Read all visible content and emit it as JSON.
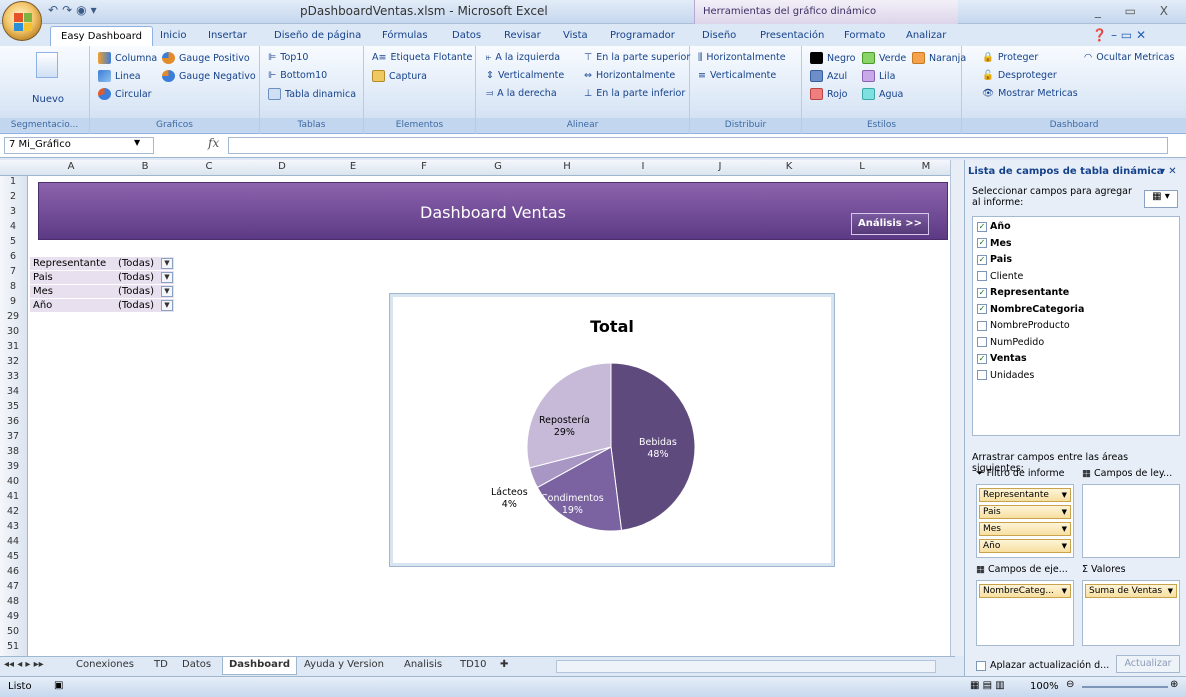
{
  "window": {
    "title": "pDashboardVentas.xlsm - Microsoft Excel",
    "context_title": "Herramientas del gráfico dinámico",
    "controls": "_ ▭ X"
  },
  "tabs": [
    "Easy Dashboard",
    "Inicio",
    "Insertar",
    "Diseño de página",
    "Fórmulas",
    "Datos",
    "Revisar",
    "Vista",
    "Programador",
    "Diseño",
    "Presentación",
    "Formato",
    "Analizar"
  ],
  "active_tab": "Easy Dashboard",
  "ribbon": {
    "segmentacion": {
      "label": "Segmentacio...",
      "nuevo": "Nuevo"
    },
    "graficos": {
      "label": "Graficos",
      "columna": "Columna",
      "linea": "Linea",
      "circular": "Circular",
      "gauge_pos": "Gauge Positivo",
      "gauge_neg": "Gauge Negativo"
    },
    "tablas": {
      "label": "Tablas",
      "top10": "Top10",
      "bottom10": "Bottom10",
      "tabla": "Tabla dinamica"
    },
    "elementos": {
      "label": "Elementos",
      "etiqueta": "Etiqueta Flotante",
      "captura": "Captura"
    },
    "alinear": {
      "label": "Alinear",
      "izq": "A la izquierda",
      "der": "A la derecha",
      "vert": "Verticalmente",
      "sup": "En la parte superior",
      "horiz": "Horizontalmente",
      "inf": "En la parte inferior"
    },
    "distribuir": {
      "label": "Distribuir",
      "horiz": "Horizontalmente",
      "vert": "Verticalmente"
    },
    "estilos": {
      "label": "Estilos",
      "negro": "Negro",
      "verde": "Verde",
      "naranja": "Naranja",
      "azul": "Azul",
      "lila": "Lila",
      "rojo": "Rojo",
      "agua": "Agua"
    },
    "dashboard": {
      "label": "Dashboard",
      "proteger": "Proteger",
      "desproteger": "Desproteger",
      "mostrar": "Mostrar Metricas",
      "ocultar": "Ocultar Metricas"
    }
  },
  "formula_bar": {
    "name_box": "7 Mi_Gráfico",
    "fx": "fx",
    "formula": ""
  },
  "columns": [
    "A",
    "B",
    "C",
    "D",
    "E",
    "F",
    "G",
    "H",
    "I",
    "J",
    "K",
    "L",
    "M"
  ],
  "rows": [
    "1",
    "2",
    "3",
    "4",
    "5",
    "6",
    "7",
    "8",
    "9",
    "29",
    "30",
    "31",
    "32",
    "33",
    "34",
    "35",
    "36",
    "37",
    "38",
    "39",
    "40",
    "41",
    "42",
    "43",
    "44",
    "45",
    "46",
    "47",
    "48",
    "49",
    "50",
    "51"
  ],
  "dashboard": {
    "title": "Dashboard Ventas",
    "analisis_button": "Análisis >>"
  },
  "filters": [
    {
      "label": "Representante",
      "value": "(Todas)"
    },
    {
      "label": "Pais",
      "value": "(Todas)"
    },
    {
      "label": "Mes",
      "value": "(Todas)"
    },
    {
      "label": "Año",
      "value": "(Todas)"
    }
  ],
  "chart_data": {
    "type": "pie",
    "title": "Total",
    "categories": [
      "Bebidas",
      "Condimentos",
      "Lácteos",
      "Repostería"
    ],
    "values": [
      48,
      19,
      4,
      29
    ],
    "labels": [
      "48%",
      "19%",
      "4%",
      "29%"
    ],
    "colors": [
      "#5f4a7e",
      "#7a63a0",
      "#a897c4",
      "#c6bad8"
    ]
  },
  "sheet_tabs": [
    "Conexiones",
    "TD",
    "Datos",
    "Dashboard",
    "Ayuda y Version",
    "Analisis",
    "TD10"
  ],
  "active_sheet": "Dashboard",
  "status": {
    "text": "Listo",
    "zoom": "100%"
  },
  "pivot_panel": {
    "title": "Lista de campos de tabla dinámica",
    "prompt": "Seleccionar campos para agregar al informe:",
    "fields": [
      {
        "name": "Año",
        "checked": true
      },
      {
        "name": "Mes",
        "checked": true
      },
      {
        "name": "Pais",
        "checked": true
      },
      {
        "name": "Cliente",
        "checked": false
      },
      {
        "name": "Representante",
        "checked": true
      },
      {
        "name": "NombreCategoria",
        "checked": true
      },
      {
        "name": "NombreProducto",
        "checked": false
      },
      {
        "name": "NumPedido",
        "checked": false
      },
      {
        "name": "Ventas",
        "checked": true
      },
      {
        "name": "Unidades",
        "checked": false
      }
    ],
    "drag_prompt": "Arrastrar campos entre las áreas siguientes:",
    "filter_area_label": "Filtro de informe",
    "legend_area_label": "Campos de ley...",
    "axis_area_label": "Campos de eje...",
    "values_area_label": "Valores",
    "filter_items": [
      "Representante",
      "Pais",
      "Mes",
      "Año"
    ],
    "axis_items": [
      "NombreCateg..."
    ],
    "value_items": [
      "Suma de Ventas"
    ],
    "defer_label": "Aplazar actualización d...",
    "update_button": "Actualizar"
  }
}
